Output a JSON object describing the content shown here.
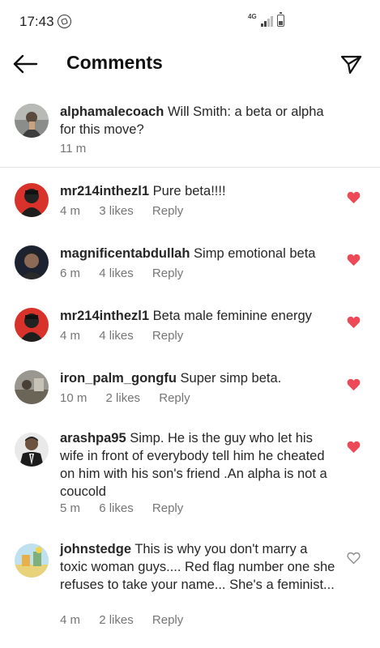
{
  "status_bar": {
    "time": "17:43",
    "network": "4G"
  },
  "header": {
    "title": "Comments"
  },
  "caption": {
    "username": "alphamalecoach",
    "text": "Will Smith: a beta or alpha for this move?",
    "time": "11 m"
  },
  "comments": [
    {
      "username": "mr214inthezl1",
      "text": "Pure beta!!!!",
      "time": "4 m",
      "likes": "3 likes",
      "reply": "Reply",
      "liked": true,
      "avatar": "red"
    },
    {
      "username": "magnificentabdullah",
      "text": "Simp emotional beta",
      "time": "6 m",
      "likes": "4 likes",
      "reply": "Reply",
      "liked": true,
      "avatar": "dark"
    },
    {
      "username": "mr214inthezl1",
      "text": "Beta male feminine energy",
      "time": "4 m",
      "likes": "4 likes",
      "reply": "Reply",
      "liked": true,
      "avatar": "red"
    },
    {
      "username": "iron_palm_gongfu",
      "text": "Super simp beta.",
      "time": "10 m",
      "likes": "2 likes",
      "reply": "Reply",
      "liked": true,
      "avatar": "gray"
    },
    {
      "username": "arashpa95",
      "text": "Simp. He is the guy who let his wife in front of everybody  tell him he cheated on him with his son's friend .An alpha is not a coucold",
      "time": "5 m",
      "likes": "6 likes",
      "reply": "Reply",
      "liked": true,
      "avatar": "suit"
    },
    {
      "username": "johnstedge",
      "text": "This is why you don't marry a toxic woman guys.... Red flag number one she refuses to take your name... She's a feminist...",
      "time": "4 m",
      "likes": "2 likes",
      "reply": "Reply",
      "liked": false,
      "avatar": "cartoon"
    }
  ],
  "colors": {
    "like_red": "#ed4956",
    "meta_gray": "#757575",
    "divider": "#e3e3e3"
  }
}
